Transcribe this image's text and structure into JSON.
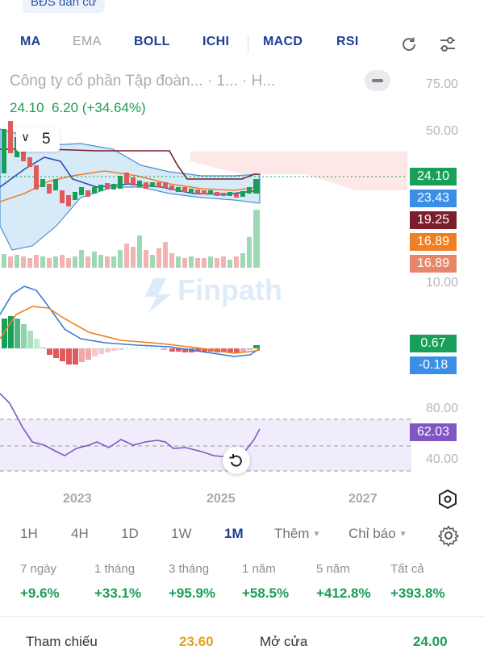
{
  "top_tag": "BĐS dân cư",
  "indicator_tabs": [
    "MA",
    "EMA",
    "BOLL",
    "ICHI",
    "MACD",
    "RSI"
  ],
  "indicator_active": [
    "MA",
    "BOLL",
    "ICHI",
    "MACD",
    "RSI"
  ],
  "header": {
    "title": "Công ty cổ phần Tập đoàn... · 1... · H...",
    "price": "24.10",
    "change": "6.20 (+34.64%)"
  },
  "ma_period": "5",
  "axis_labels": {
    "price": [
      "75.00",
      "50.00"
    ],
    "macd": [
      "10.00"
    ],
    "rsi": [
      "80.00",
      "40.00"
    ]
  },
  "badges": [
    {
      "value": "24.10",
      "color": "#19a058"
    },
    {
      "value": "23.43",
      "color": "#3a8ee6"
    },
    {
      "value": "19.25",
      "color": "#7a1f2b"
    },
    {
      "value": "16.89",
      "color": "#f07e22"
    },
    {
      "value": "16.89",
      "color": "#e8866a"
    },
    {
      "value": "0.67",
      "color": "#19a058"
    },
    {
      "value": "-0.18",
      "color": "#3a8ee6"
    },
    {
      "value": "62.03",
      "color": "#7e57c2"
    }
  ],
  "watermark": "Finpath",
  "years": [
    "2023",
    "2025",
    "2027"
  ],
  "timeframes": [
    "1H",
    "4H",
    "1D",
    "1W",
    "1M"
  ],
  "timeframe_active": "1M",
  "more_label": "Thêm",
  "indicator_label": "Chỉ báo",
  "performance": [
    {
      "label": "7 ngày",
      "value": "+9.6%"
    },
    {
      "label": "1 tháng",
      "value": "+33.1%"
    },
    {
      "label": "3 tháng",
      "value": "+95.9%"
    },
    {
      "label": "1 năm",
      "value": "+58.5%"
    },
    {
      "label": "5 năm",
      "value": "+412.8%"
    },
    {
      "label": "Tất cả",
      "value": "+393.8%"
    }
  ],
  "footer": {
    "ref_label": "Tham chiếu",
    "ref_value": "23.60",
    "open_label": "Mở cửa",
    "open_value": "24.00"
  },
  "colors": {
    "up": "#1a9e55",
    "down": "#e05a5a",
    "accent": "#1f3f95",
    "rsi": "#7e57c2"
  },
  "chart_data": {
    "type": "candlestick",
    "timeframe": "1M",
    "price_axis": {
      "ticks": [
        75.0,
        50.0
      ]
    },
    "last_close": 24.1,
    "ma": 23.43,
    "rsi": {
      "value": 62.03,
      "ticks": [
        80.0,
        40.0
      ]
    },
    "macd": {
      "macd": 0.67,
      "signal": -0.18
    }
  }
}
